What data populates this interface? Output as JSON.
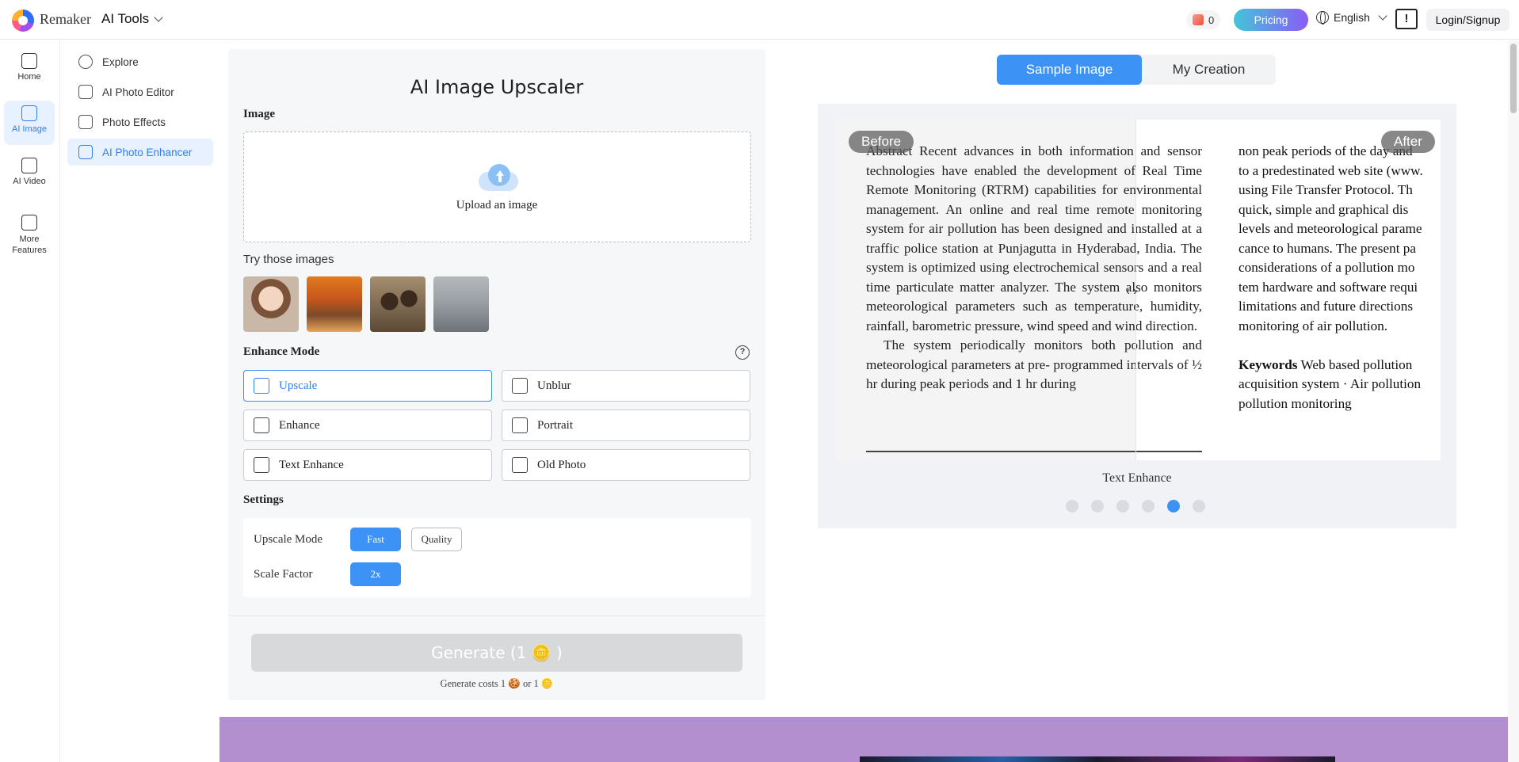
{
  "header": {
    "brand": "Remaker",
    "menu_label": "AI Tools",
    "credits": "0",
    "pricing": "Pricing",
    "language": "English",
    "login": "Login/Signup"
  },
  "rail": [
    {
      "label": "Home"
    },
    {
      "label": "AI Image"
    },
    {
      "label": "AI Video"
    },
    {
      "label": "More Features"
    }
  ],
  "subnav": [
    {
      "label": "Explore"
    },
    {
      "label": "AI Photo Editor"
    },
    {
      "label": "Photo Effects"
    },
    {
      "label": "AI Photo Enhancer"
    }
  ],
  "form": {
    "title": "AI Image Upscaler",
    "image_label": "Image",
    "upload_text": "Upload an image",
    "try_label": "Try those images",
    "enhance_label": "Enhance Mode",
    "modes": [
      "Upscale",
      "Unblur",
      "Enhance",
      "Portrait",
      "Text Enhance",
      "Old Photo"
    ],
    "settings_label": "Settings",
    "upscale_mode_label": "Upscale Mode",
    "upscale_fast": "Fast",
    "upscale_quality": "Quality",
    "scale_factor_label": "Scale Factor",
    "scale_value": "2x",
    "generate": "Generate (1 🪙 )",
    "cost": "Generate costs 1 🍪 or 1 🪙"
  },
  "preview": {
    "tab_sample": "Sample Image",
    "tab_creation": "My Creation",
    "before": "Before",
    "after": "After",
    "caption": "Text Enhance",
    "active_dot": 5,
    "paper_main": "Abstract Recent advances in both information and sensor technologies have enabled the development of Real Time Remote Monitoring (RTRM) capabilities for environmental management. An online and real time remote monitoring system for air pollution has been designed and installed at a traffic police station at Punjagutta in Hyderabad, India. The system is optimized using electrochemical sensors and a real time particulate matter analyzer. The system also monitors meteorological parameters such as temperature, humidity, rainfall, barometric pressure, wind speed and wind direction.",
    "paper_para2": "The system periodically monitors both pollution and meteorological parameters at pre- programmed intervals of ½ hr during peak periods and 1 hr during",
    "col2_lines": [
      "non peak periods of the day and",
      "to a predestinated web site (www.",
      "using File Transfer Protocol. Th",
      "quick, simple and graphical dis",
      "levels and meteorological parame",
      "cance to humans. The present pa",
      "considerations of a pollution mo",
      "tem hardware and software requi",
      "limitations and future directions",
      "monitoring of air pollution."
    ],
    "keywords_label": "Keywords",
    "keywords_lines": [
      " Web based pollution",
      "acquisition system · Air pollution",
      "pollution monitoring"
    ]
  }
}
